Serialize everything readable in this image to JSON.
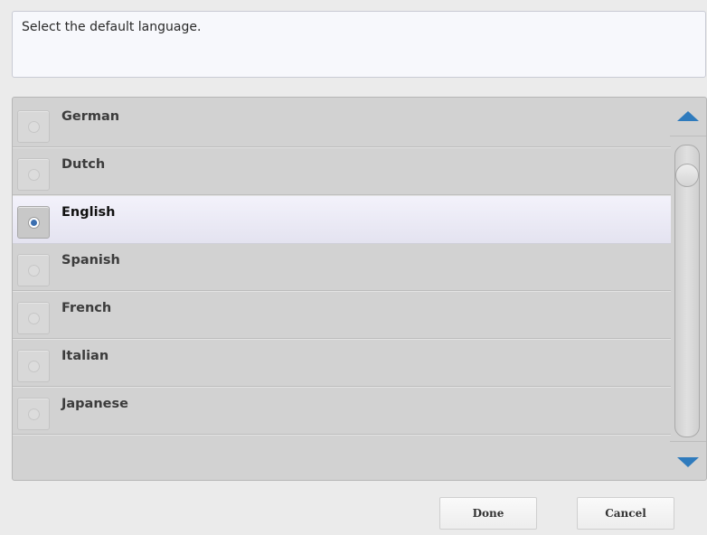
{
  "prompt": {
    "text": "Select the default language."
  },
  "language_list": {
    "items": [
      {
        "label": "German",
        "selected": false
      },
      {
        "label": "Dutch",
        "selected": false
      },
      {
        "label": "English",
        "selected": true
      },
      {
        "label": "Spanish",
        "selected": false
      },
      {
        "label": "French",
        "selected": false
      },
      {
        "label": "Italian",
        "selected": false
      },
      {
        "label": "Japanese",
        "selected": false
      }
    ]
  },
  "scrollbar": {
    "up_icon": "triangle-up-icon",
    "down_icon": "triangle-down-icon",
    "arrow_color": "#2f7bbd"
  },
  "actions": {
    "done_label": "Done",
    "cancel_label": "Cancel"
  },
  "colors": {
    "selected_row": "#ecebf6",
    "radio_selected": "#3b6fb0"
  }
}
